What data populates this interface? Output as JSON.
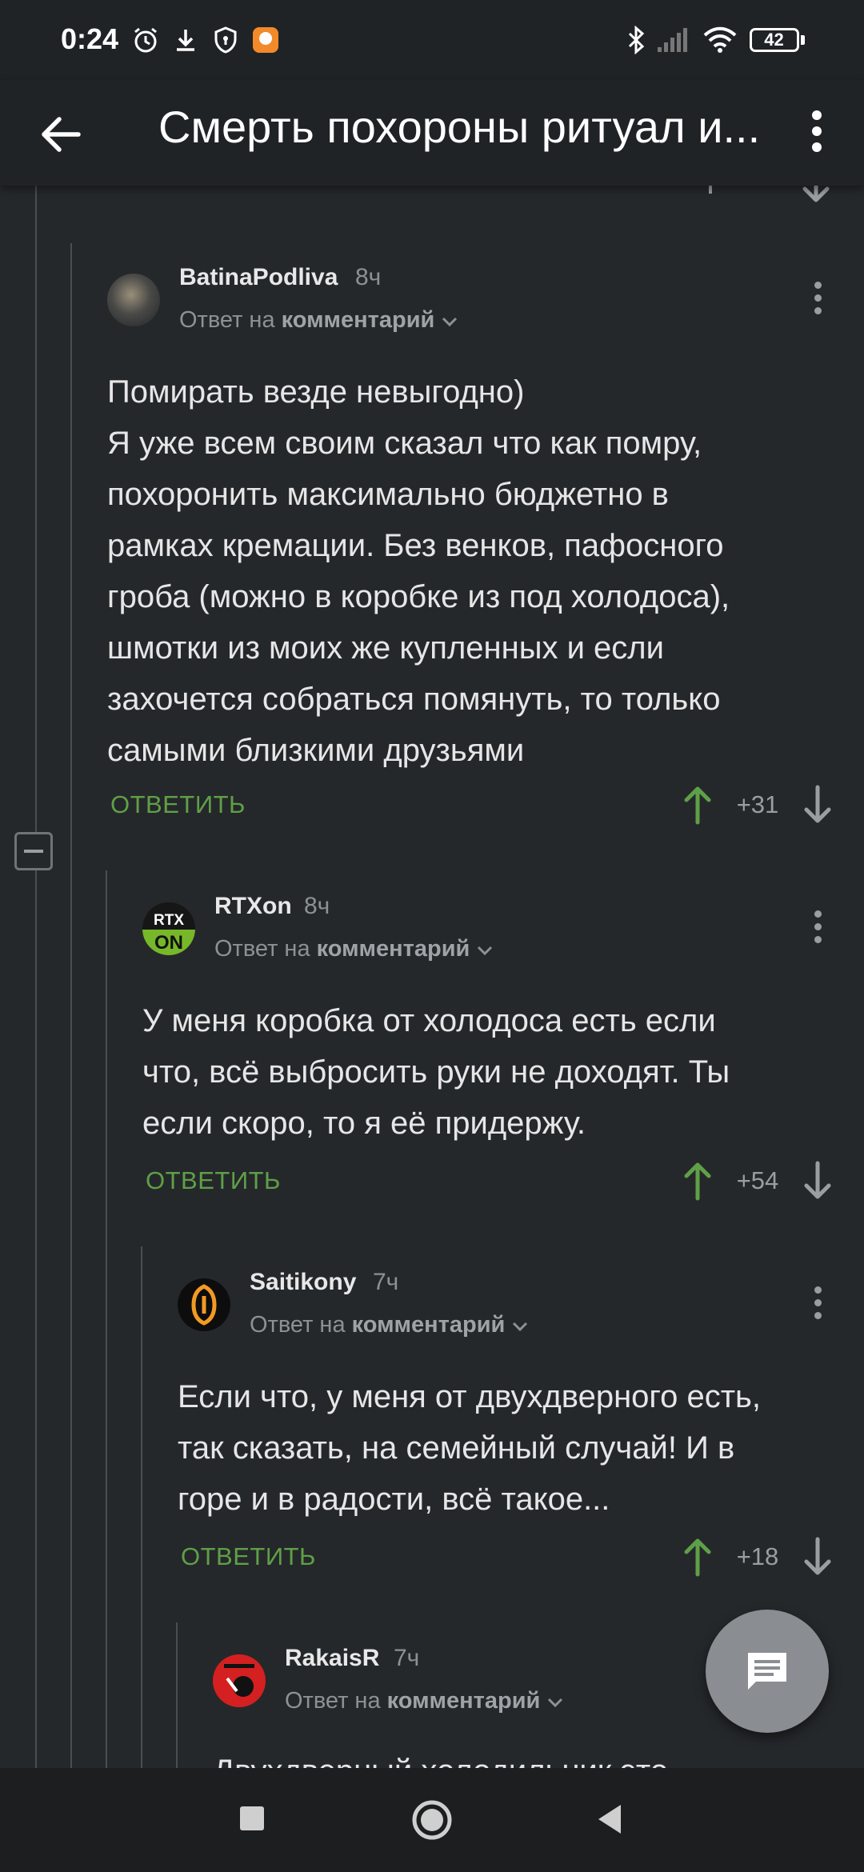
{
  "status_bar": {
    "time": "0:24",
    "battery": "42"
  },
  "app_bar": {
    "title": "Смерть похороны ритуал и..."
  },
  "comments": [
    {
      "author": "BatinaPodliva",
      "time": "8ч",
      "reply_prefix": "Ответ на",
      "reply_target": "комментарий",
      "lines": [
        "Помирать везде невыгодно)",
        "Я уже всем своим сказал что как помру,",
        "похоронить максимально бюджетно в",
        "рамках кремации. Без венков, пафосного",
        "гроба (можно в коробке из под холодоса),",
        "шмотки из моих же купленных и если",
        "захочется собраться помянуть, то только",
        "самыми близкими друзьями"
      ],
      "reply_label": "ОТВЕТИТЬ",
      "score": "+31"
    },
    {
      "author": "RTXon",
      "time": "8ч",
      "reply_prefix": "Ответ на",
      "reply_target": "комментарий",
      "avatar_text": {
        "top": "RTX",
        "bottom": "ON"
      },
      "lines": [
        "У меня коробка от холодоса есть если",
        "что, всё выбросить руки не доходят. Ты",
        "если скоро, то я её придержу."
      ],
      "reply_label": "ОТВЕТИТЬ",
      "score": "+54"
    },
    {
      "author": "Saitikony",
      "time": "7ч",
      "reply_prefix": "Ответ на",
      "reply_target": "комментарий",
      "lines": [
        "Если что, у меня от двухдверного есть,",
        "так сказать, на семейный случай! И в",
        "горе и в радости, всё такое..."
      ],
      "reply_label": "ОТВЕТИТЬ",
      "score": "+18"
    },
    {
      "author": "RakaisR",
      "time": "7ч",
      "reply_prefix": "Ответ на",
      "reply_target": "комментарий",
      "lines": [
        "Двухдверный холодильник это"
      ]
    }
  ],
  "colors": {
    "background": "#25282b",
    "bar": "#202326",
    "accent_green": "#5fa047",
    "muted": "#8c9196",
    "fab": "#8a8e92"
  },
  "icons": {
    "back": "arrow-left-icon",
    "menu": "more-vert-icon",
    "upvote": "arrow-up-icon",
    "downvote": "arrow-down-icon",
    "fab": "comment-icon"
  }
}
